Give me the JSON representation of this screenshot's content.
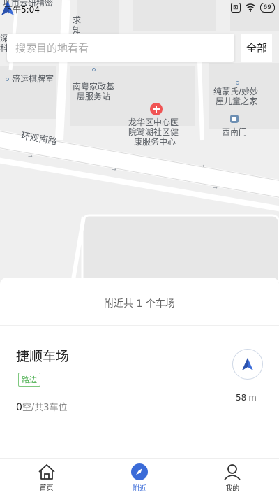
{
  "status_bar": {
    "time": "下午5:04",
    "sim_label": "⊠",
    "battery": "69"
  },
  "map": {
    "labels": {
      "top_fragment": "圳市云研精密",
      "left_fragment_1": "深",
      "left_fragment_2": "科",
      "right_fragment_1": "求",
      "right_fragment_2": "知",
      "poi_chess": "盛运棋牌室",
      "poi_nanyue": "南粤家政基层服务站",
      "poi_nanyue_l1": "南粤家政基",
      "poi_nanyue_l2": "层服务站",
      "poi_kids_l1": "纯蒙氏/妙妙",
      "poi_kids_l2": "屋儿童之家",
      "poi_hospital_l1": "龙华区中心医",
      "poi_hospital_l2": "院鹭湖社区健",
      "poi_hospital_l3": "康服务中心",
      "poi_westgate": "西南门",
      "road": "环观南路"
    },
    "colors": {
      "road": "#ffffff",
      "block": "#e4e4e4",
      "hospital": "#f05454",
      "arrow": "#3a6bd8"
    }
  },
  "search": {
    "placeholder": "搜索目的地看看",
    "all_label": "全部"
  },
  "sheet": {
    "summary": "附近共 1 个车场",
    "lot": {
      "name": "捷顺车场",
      "tag": "路边",
      "available": "0",
      "available_suffix": "空/共3车位",
      "distance_value": "58",
      "distance_unit": "m"
    }
  },
  "tabbar": {
    "tabs": [
      {
        "label": "首页",
        "icon": "home-icon",
        "active": false
      },
      {
        "label": "附近",
        "icon": "compass-icon",
        "active": true
      },
      {
        "label": "我的",
        "icon": "user-icon",
        "active": false
      }
    ]
  }
}
